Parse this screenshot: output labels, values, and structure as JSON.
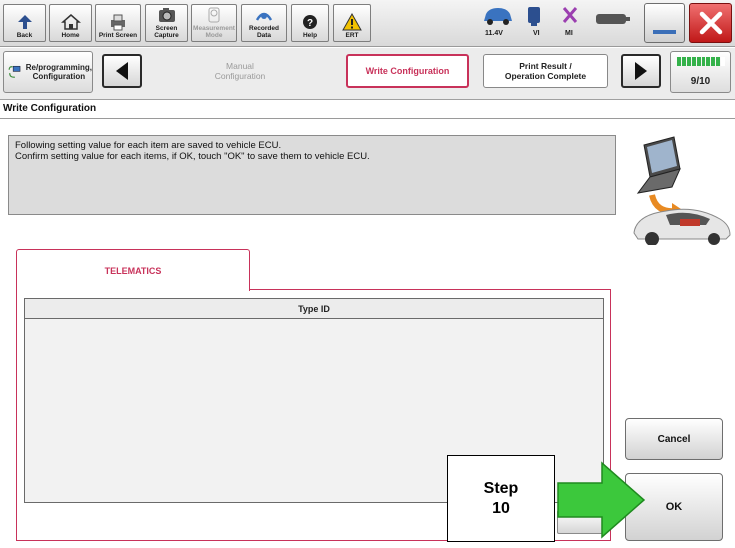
{
  "toolbar": {
    "buttons": [
      {
        "label": "Back",
        "icon": "back-arrow-icon"
      },
      {
        "label": "Home",
        "icon": "home-icon"
      },
      {
        "label": "Print Screen",
        "icon": "printer-icon"
      },
      {
        "label": "Screen\nCapture",
        "icon": "camera-icon"
      },
      {
        "label": "Measurement\nMode",
        "icon": "measurement-icon"
      },
      {
        "label": "Recorded\nData",
        "icon": "recorded-data-icon"
      },
      {
        "label": "Help",
        "icon": "help-icon"
      },
      {
        "label": "ERT",
        "icon": "warning-icon"
      }
    ],
    "status": {
      "battery_voltage": "11.4V",
      "vi_label": "VI",
      "mi_label": "MI"
    }
  },
  "nav": {
    "section_label": "Re/programming,\nConfiguration",
    "steps": {
      "manual": "Manual\nConfiguration",
      "write": "Write Configuration",
      "print": "Print Result /\nOperation Complete"
    },
    "progress": {
      "text": "9/10",
      "value": 0.9
    }
  },
  "page": {
    "title": "Write Configuration",
    "message": {
      "line1": "Following setting value for each item are saved to vehicle ECU.",
      "line2": "Confirm setting value for each items, if OK, touch \"OK\" to save them to vehicle ECU."
    }
  },
  "tab": {
    "label": "TELEMATICS",
    "table_header": "Type ID"
  },
  "actions": {
    "cancel": "Cancel",
    "ok": "OK"
  },
  "annotation": {
    "line1": "Step",
    "line2": "10",
    "arrow_color": "#3cc83c"
  },
  "colors": {
    "accent": "#c8325a",
    "progress": "#34b24a",
    "close": "#c01818"
  }
}
